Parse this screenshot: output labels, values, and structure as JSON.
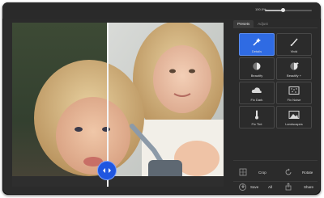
{
  "zoom": {
    "label": "100.0%",
    "fraction": 0.38
  },
  "canvas": {
    "split_fraction": 0.45
  },
  "panel": {
    "tabs": [
      {
        "label": "Presets",
        "active": true
      },
      {
        "label": "Adjust",
        "active": false
      }
    ],
    "presets": [
      {
        "label": "Details",
        "icon": "magic-wand-icon",
        "selected": true
      },
      {
        "label": "Vivid",
        "icon": "brush-icon",
        "selected": false
      },
      {
        "label": "Beautify",
        "icon": "beautify-icon",
        "selected": false
      },
      {
        "label": "Beautify +",
        "icon": "beautify-plus-icon",
        "selected": false
      },
      {
        "label": "Fix Dark",
        "icon": "cloud-icon",
        "selected": false
      },
      {
        "label": "Fix Noise",
        "icon": "noise-icon",
        "selected": false
      },
      {
        "label": "Fix Tint",
        "icon": "thermometer-icon",
        "selected": false
      },
      {
        "label": "Landscapes",
        "icon": "landscape-icon",
        "selected": false
      }
    ],
    "tools": {
      "crop": "Crop",
      "rotate": "Rotate"
    },
    "actions": {
      "save": "Save",
      "all": "All",
      "share": "Share"
    }
  },
  "colors": {
    "accent": "#2f6be3",
    "panel_bg": "#2b2b2b"
  }
}
